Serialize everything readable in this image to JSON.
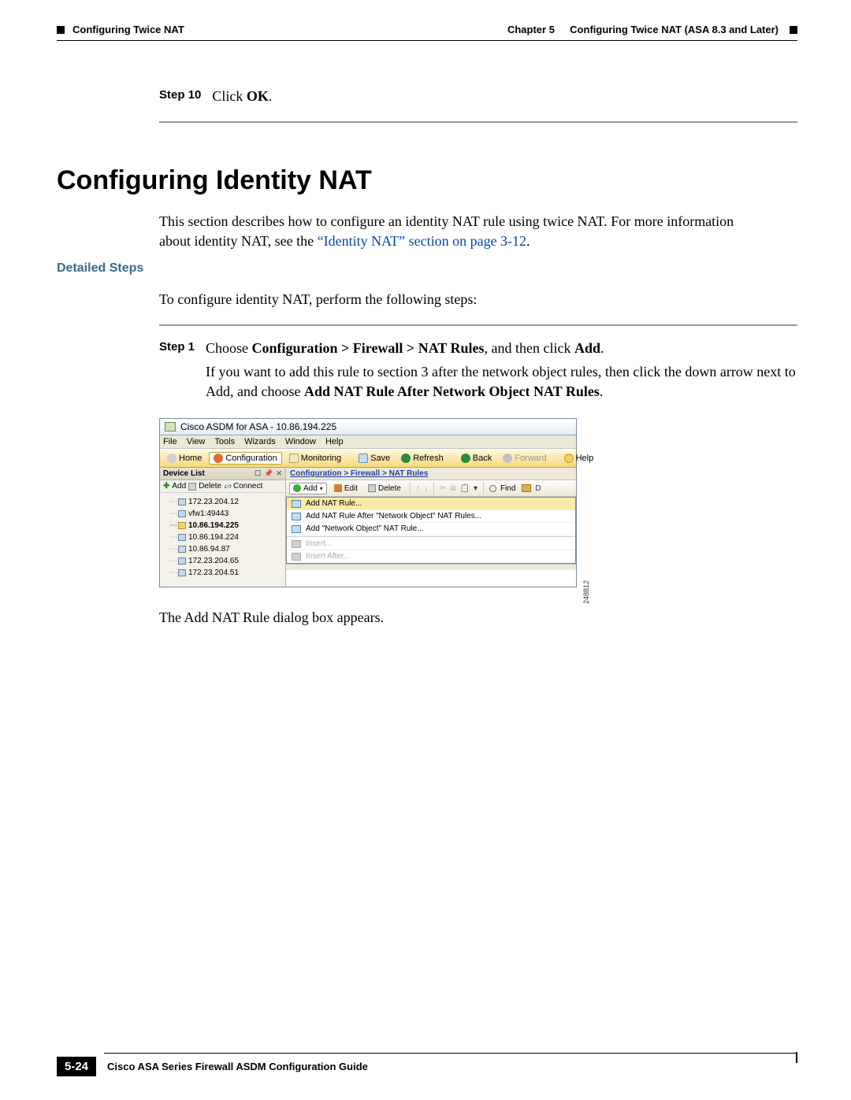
{
  "header": {
    "leftSection": "Configuring Twice NAT",
    "rightChapter": "Chapter 5",
    "rightTitle": "Configuring Twice NAT (ASA 8.3 and Later)"
  },
  "step10": {
    "label": "Step 10",
    "pre": "Click ",
    "bold": "OK",
    "post": "."
  },
  "sectionHeading": "Configuring Identity NAT",
  "intro": {
    "l1": "This section describes how to configure an identity NAT rule using twice NAT. For more information",
    "l2a": "about identity NAT, see the ",
    "link": "“Identity NAT” section on page 3-12",
    "l2b": "."
  },
  "detailedSteps": "Detailed Steps",
  "leadline": "To configure identity NAT, perform the following steps:",
  "step1": {
    "label": "Step 1",
    "l1a": "Choose ",
    "l1b": "Configuration > Firewall > NAT Rules",
    "l1c": ", and then click ",
    "l1d": "Add",
    "l1e": ".",
    "l2": "If you want to add this rule to section 3 after the network object rules, then click the down arrow next to",
    "l3a": "Add, and choose ",
    "l3b": "Add NAT Rule After Network Object NAT Rules",
    "l3c": "."
  },
  "screenshot": {
    "title": "Cisco ASDM      for ASA - 10.86.194.225",
    "menus": [
      "File",
      "View",
      "Tools",
      "Wizards",
      "Window",
      "Help"
    ],
    "toolbar": {
      "home": "Home",
      "configuration": "Configuration",
      "monitoring": "Monitoring",
      "save": "Save",
      "refresh": "Refresh",
      "back": "Back",
      "forward": "Forward",
      "help": "Help"
    },
    "deviceList": {
      "title": "Device List",
      "add": "Add",
      "delete": "Delete",
      "connect": "Connect",
      "items": [
        "172.23.204.12",
        "vfw1:49443",
        "10.86.194.225",
        "10.86.194.224",
        "10.86.94.87",
        "172.23.204.65",
        "172.23.204.51"
      ],
      "selectedIndex": 2
    },
    "breadcrumb": "Configuration > Firewall > NAT Rules",
    "rightToolbar": {
      "add": "Add",
      "edit": "Edit",
      "delete": "Delete",
      "find": "Find"
    },
    "dropdown": {
      "i0": "Add NAT Rule...",
      "i1": "Add NAT Rule After \"Network Object\" NAT Rules...",
      "i2": "Add \"Network Object\" NAT Rule...",
      "i3": "Insert...",
      "i4": "Insert After..."
    },
    "figId": "248812"
  },
  "afterFigure": "The Add NAT Rule dialog box appears.",
  "footer": {
    "pageNum": "5-24",
    "guide": "Cisco ASA Series Firewall ASDM Configuration Guide"
  }
}
